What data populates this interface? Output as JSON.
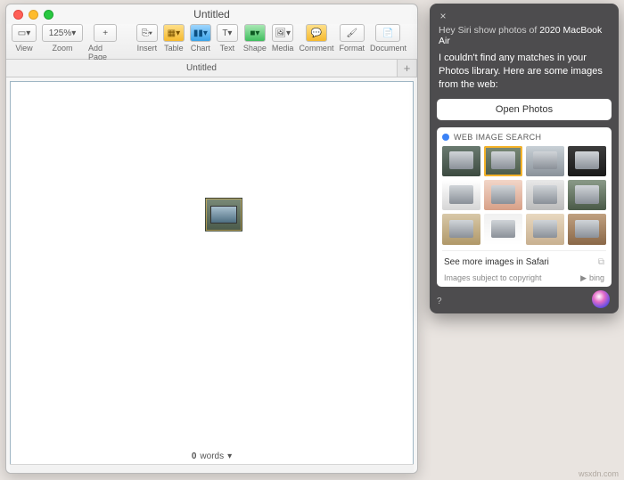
{
  "pages": {
    "title": "Untitled",
    "toolbar": {
      "view": "View",
      "zoom_value": "125%",
      "zoom": "Zoom",
      "add_page_plus": "+",
      "add_page": "Add Page",
      "insert": "Insert",
      "table": "Table",
      "chart": "Chart",
      "text": "Text",
      "shape": "Shape",
      "media": "Media",
      "comment": "Comment",
      "format": "Format",
      "document": "Document"
    },
    "tab_label": "Untitled",
    "tab_add": "+",
    "footer_count": "0",
    "footer_word": "words"
  },
  "siri": {
    "close": "×",
    "query_prefix": "Hey Siri show photos of ",
    "query_highlight": "2020 MacBook Air",
    "message": "I couldn't find any matches in your Photos library. Here are some images from the web:",
    "open_photos": "Open Photos",
    "card_title": "WEB IMAGE SEARCH",
    "see_more": "See more images in Safari",
    "copyright": "Images subject to copyright",
    "bing": "bing",
    "help": "?"
  },
  "watermark": "wsxdn.com"
}
